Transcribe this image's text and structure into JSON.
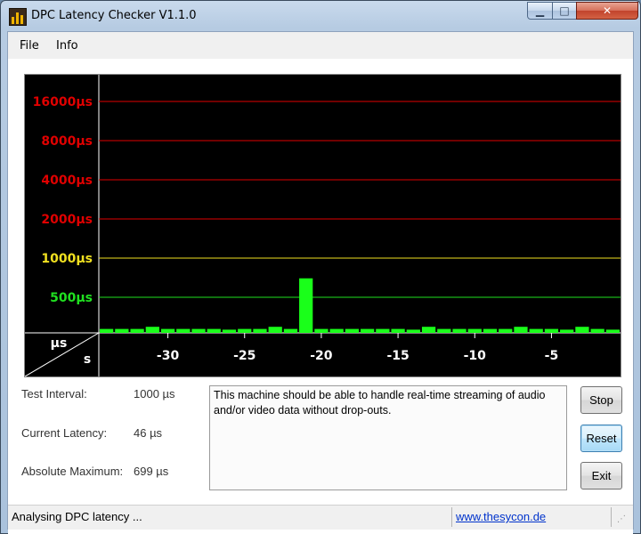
{
  "window": {
    "title": "DPC Latency Checker V1.1.0",
    "controls": {
      "minimize": "▁",
      "maximize": "□",
      "close": "✕"
    }
  },
  "menu": [
    "File",
    "Info"
  ],
  "chart_data": {
    "type": "bar",
    "y_scale": "logarithmic",
    "y_tick_labels": [
      {
        "label": "16000µs",
        "value": 16000,
        "color": "#e00000"
      },
      {
        "label": "8000µs",
        "value": 8000,
        "color": "#e00000"
      },
      {
        "label": "4000µs",
        "value": 4000,
        "color": "#e00000"
      },
      {
        "label": "2000µs",
        "value": 2000,
        "color": "#e00000"
      },
      {
        "label": "1000µs",
        "value": 1000,
        "color": "#f0e020"
      },
      {
        "label": "500µs",
        "value": 500,
        "color": "#20e020"
      }
    ],
    "x_tick_labels": [
      "-30",
      "-25",
      "-20",
      "-15",
      "-10",
      "-5"
    ],
    "x_ticks": [
      -30,
      -25,
      -20,
      -15,
      -10,
      -5
    ],
    "x_range": [
      -34.5,
      -0.5
    ],
    "corner_labels": {
      "y_unit": "µs",
      "x_unit": "s"
    },
    "bar_color": "#1aff1a",
    "x": [
      -34,
      -33,
      -32,
      -31,
      -30,
      -29,
      -28,
      -27,
      -26,
      -25,
      -24,
      -23,
      -22,
      -21,
      -20,
      -19,
      -18,
      -17,
      -16,
      -15,
      -14,
      -13,
      -12,
      -11,
      -10,
      -9,
      -8,
      -7,
      -6,
      -5,
      -4,
      -3,
      -2,
      -1
    ],
    "values": [
      55,
      55,
      55,
      85,
      55,
      55,
      55,
      55,
      45,
      55,
      55,
      85,
      55,
      699,
      55,
      55,
      55,
      55,
      55,
      55,
      45,
      85,
      55,
      55,
      55,
      55,
      55,
      85,
      55,
      55,
      45,
      85,
      55,
      45
    ]
  },
  "stats": {
    "test_interval_label": "Test Interval:",
    "test_interval_value": "1000 µs",
    "current_latency_label": "Current Latency:",
    "current_latency_value": "46 µs",
    "absolute_maximum_label": "Absolute Maximum:",
    "absolute_maximum_value": "699 µs"
  },
  "message": "This machine should be able to handle real-time streaming of audio and/or video data without drop-outs.",
  "buttons": {
    "stop": "Stop",
    "reset": "Reset",
    "exit": "Exit"
  },
  "status": {
    "text": "Analysing DPC latency ...",
    "link": "www.thesycon.de"
  }
}
